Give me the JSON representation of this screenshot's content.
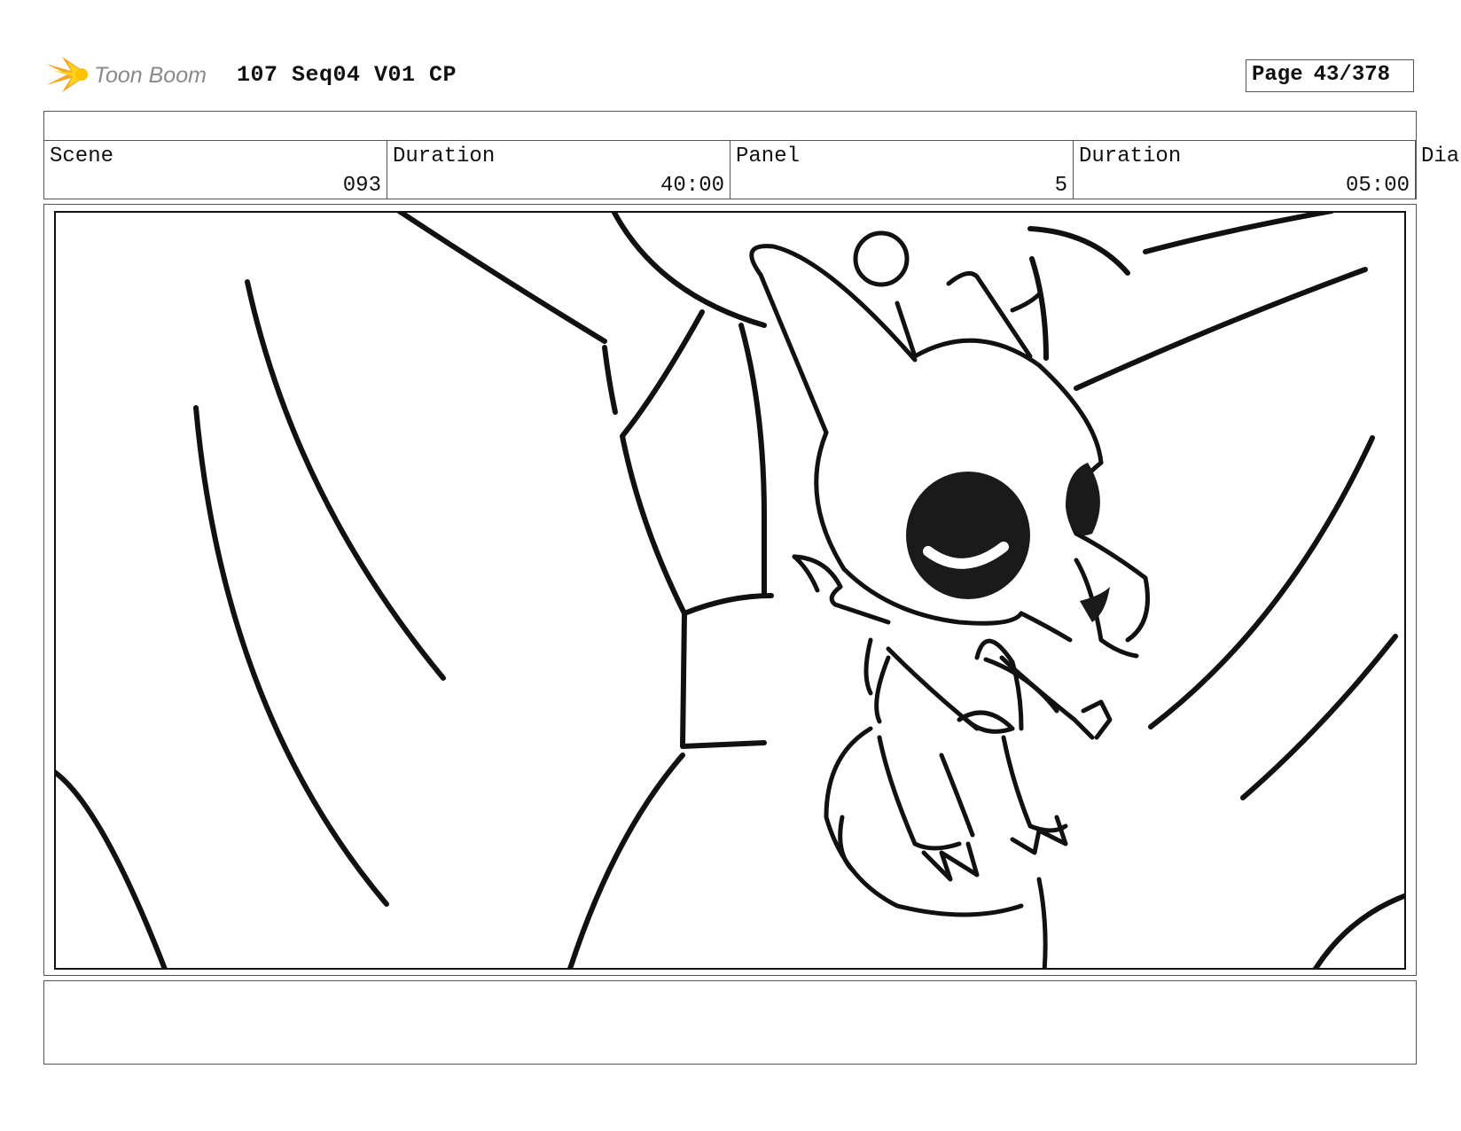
{
  "header": {
    "logo_text": "Toon Boom",
    "project_title": "107 Seq04 V01 CP",
    "page_label": "Page",
    "page_number": "43/378"
  },
  "info": {
    "scene_label": "Scene",
    "scene_value": "093",
    "scene_duration_label": "Duration",
    "scene_duration_value": "40:00",
    "panel_label": "Panel",
    "panel_value": "5",
    "panel_duration_label": "Duration",
    "panel_duration_value": "05:00",
    "dialog_label_truncated": "Dia"
  },
  "panel_image": {
    "description_icon": "storyboard-sketch-icon"
  },
  "colors": {
    "logo_orange": "#f5a623",
    "logo_yellow": "#ffd21f",
    "logo_text_gray": "#8a8a8a",
    "border_gray": "#555555",
    "ink": "#111111"
  }
}
